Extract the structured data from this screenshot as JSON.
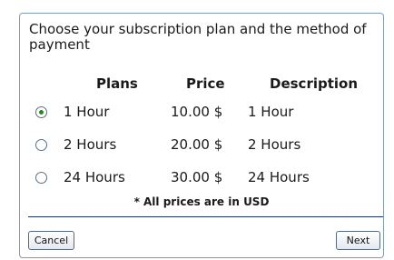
{
  "heading": "Choose your subscription plan and the method of payment",
  "table": {
    "headers": {
      "plans": "Plans",
      "price": "Price",
      "description": "Description"
    },
    "rows": [
      {
        "plan": "1 Hour",
        "price": "10.00 $",
        "description": "1 Hour",
        "selected": true
      },
      {
        "plan": "2 Hours",
        "price": "20.00 $",
        "description": "2 Hours",
        "selected": false
      },
      {
        "plan": "24 Hours",
        "price": "30.00 $",
        "description": "24 Hours",
        "selected": false
      }
    ]
  },
  "footnote": "* All prices are in USD",
  "buttons": {
    "cancel": "Cancel",
    "next": "Next"
  },
  "colors": {
    "panel_border": "#7f9db9",
    "divider": "#1a2f6e",
    "radio_selected": "#1e8f1e"
  }
}
